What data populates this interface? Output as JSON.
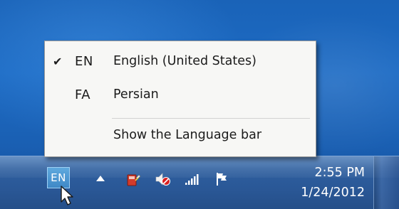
{
  "language_menu": {
    "items": [
      {
        "checked": true,
        "checkmark": "✔",
        "code": "EN",
        "name": "English (United States)"
      },
      {
        "checked": false,
        "checkmark": "",
        "code": "FA",
        "name": "Persian"
      }
    ],
    "show_language_bar": "Show the Language bar"
  },
  "taskbar": {
    "language_indicator": "EN",
    "clock": {
      "time": "2:55 PM",
      "date": "1/24/2012"
    },
    "tray_icons": [
      "chevron-up-icon",
      "power-plug-icon",
      "volume-muted-icon",
      "network-signal-icon",
      "action-center-flag-icon"
    ]
  },
  "colors": {
    "desktop": "#1a63b8",
    "taskbar": "#2a5897",
    "menu_background": "#f7f7f5",
    "language_indicator": "#4a95d0"
  }
}
